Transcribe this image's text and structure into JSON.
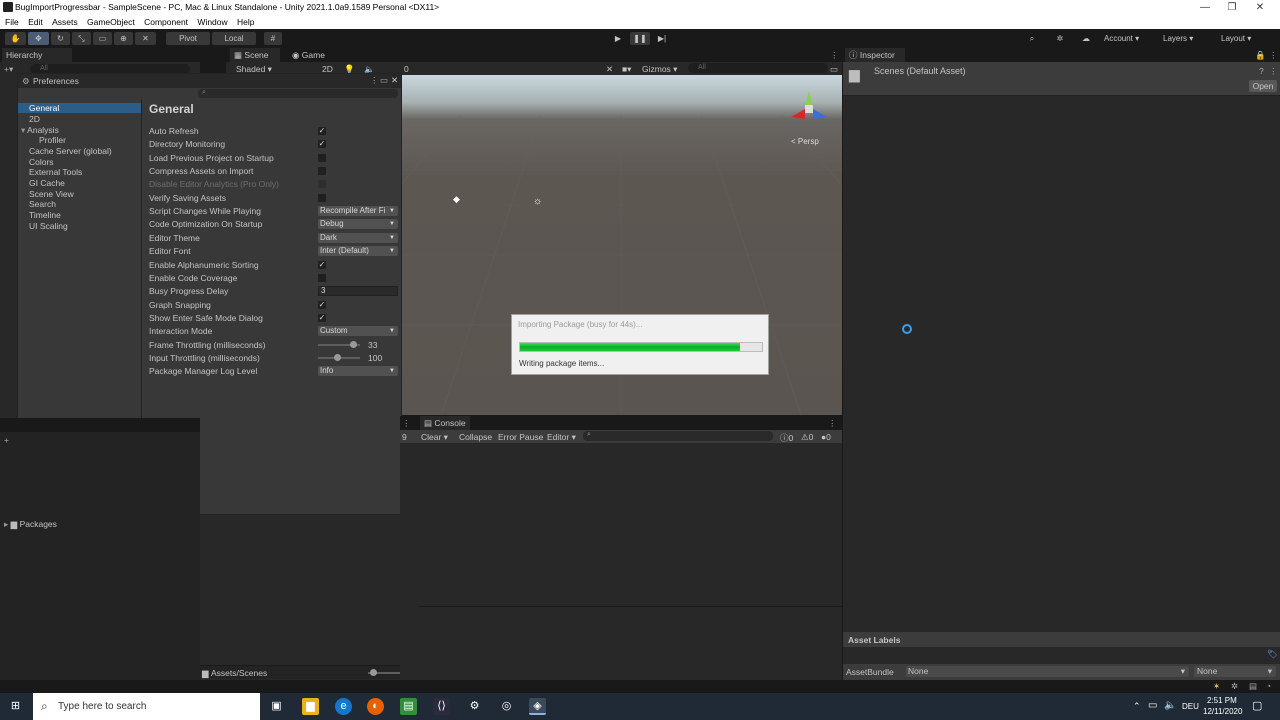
{
  "window": {
    "title": "BugImportProgressbar - SampleScene - PC, Mac & Linux Standalone - Unity 2021.1.0a9.1589 Personal <DX11>",
    "minimize": "—",
    "maximize": "❐",
    "close": "✕"
  },
  "menu": [
    "File",
    "Edit",
    "Assets",
    "GameObject",
    "Component",
    "Window",
    "Help"
  ],
  "toolbar": {
    "pivot": "Pivot",
    "local": "Local",
    "account": "Account",
    "layers": "Layers",
    "layout": "Layout"
  },
  "hierarchy": {
    "tab": "Hierarchy",
    "search_placeholder": "All"
  },
  "scene": {
    "tab_scene": "Scene",
    "tab_game": "Game",
    "shading": "Shaded",
    "mode_2d": "2D",
    "layer_count": "0",
    "gizmos": "Gizmos",
    "search_placeholder": "All",
    "persp": "< Persp"
  },
  "preferences": {
    "tab": "Preferences",
    "heading": "General",
    "categories": [
      "General",
      "2D",
      "Analysis",
      "Profiler",
      "Cache Server (global)",
      "Colors",
      "External Tools",
      "GI Cache",
      "Scene View",
      "Search",
      "Timeline",
      "UI Scaling"
    ],
    "rows": [
      {
        "label": "Auto Refresh",
        "type": "check",
        "checked": true
      },
      {
        "label": "Directory Monitoring",
        "type": "check",
        "checked": true
      },
      {
        "label": "Load Previous Project on Startup",
        "type": "check",
        "checked": false
      },
      {
        "label": "Compress Assets on Import",
        "type": "check",
        "checked": false
      },
      {
        "label": "Disable Editor Analytics (Pro Only)",
        "type": "check",
        "checked": false,
        "disabled": true
      },
      {
        "label": "Verify Saving Assets",
        "type": "check",
        "checked": false
      },
      {
        "label": "Script Changes While Playing",
        "type": "dropdown",
        "value": "Recompile After Fi"
      },
      {
        "label": "Code Optimization On Startup",
        "type": "dropdown",
        "value": "Debug"
      },
      {
        "label": "Editor Theme",
        "type": "dropdown",
        "value": "Dark"
      },
      {
        "label": "Editor Font",
        "type": "dropdown",
        "value": "Inter (Default)"
      },
      {
        "label": "Enable Alphanumeric Sorting",
        "type": "check",
        "checked": true
      },
      {
        "label": "Enable Code Coverage",
        "type": "check",
        "checked": false
      },
      {
        "label": "Busy Progress Delay",
        "type": "number",
        "value": "3"
      },
      {
        "label": "Graph Snapping",
        "type": "check",
        "checked": true
      },
      {
        "label": "Show Enter Safe Mode Dialog",
        "type": "check",
        "checked": true
      },
      {
        "label": "Interaction Mode",
        "type": "dropdown",
        "value": "Custom"
      },
      {
        "label": "Frame Throttling (milliseconds)",
        "type": "slider",
        "value": "33",
        "fraction": 0.83
      },
      {
        "label": "Input Throttling (milliseconds)",
        "type": "slider",
        "value": "100",
        "fraction": 0.46
      },
      {
        "label": "Package Manager Log Level",
        "type": "dropdown",
        "value": "Info"
      }
    ]
  },
  "dialog": {
    "title": "Importing Package (busy for 44s)...",
    "status": "Writing package items...",
    "progress": 0.91
  },
  "console": {
    "tab": "Console",
    "clear": "Clear",
    "collapse": "Collapse",
    "error_pause": "Error Pause",
    "editor": "Editor",
    "count_log": "0",
    "count_warn": "0",
    "count_err": "0",
    "hidden_count": "9"
  },
  "project": {
    "packages": "Packages",
    "path": "Assets/Scenes"
  },
  "inspector": {
    "tab": "Inspector",
    "asset_title": "Scenes (Default Asset)",
    "open": "Open",
    "asset_labels": "Asset Labels",
    "asset_bundle": "AssetBundle",
    "bundle_value": "None",
    "variant_value": "None"
  },
  "taskbar": {
    "search_placeholder": "Type here to search",
    "language": "DEU",
    "time": "2:51 PM",
    "date": "12/11/2020"
  }
}
